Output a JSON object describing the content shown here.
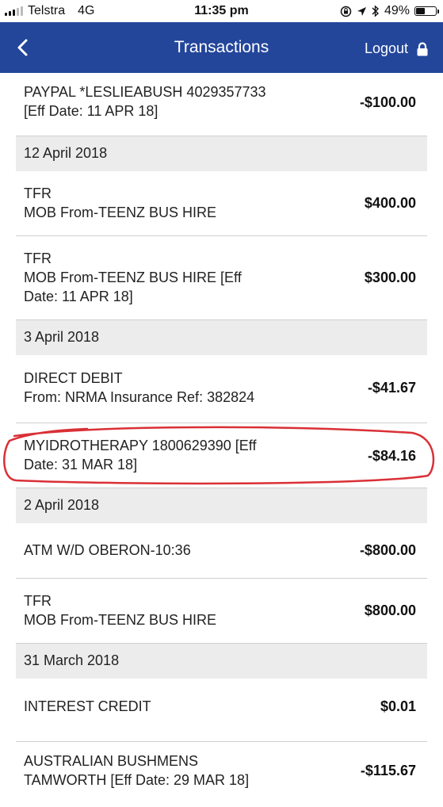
{
  "status_bar": {
    "carrier": "Telstra",
    "network": "4G",
    "time": "11:35 pm",
    "battery": "49%",
    "battery_level": 0.49
  },
  "header": {
    "title": "Transactions",
    "logout_label": "Logout"
  },
  "transactions": [
    {
      "line1": "PAYPAL *LESLIEABUSH 4029357733",
      "line2": "[Eff Date: 11 APR 18]",
      "amount": "-$100.00"
    },
    {
      "date_header": "12 April 2018"
    },
    {
      "line1": "TFR",
      "line2": "MOB From-TEENZ BUS HIRE",
      "amount": "$400.00"
    },
    {
      "line1": "TFR",
      "line2": "MOB From-TEENZ BUS HIRE [Eff",
      "line3": "Date: 11 APR 18]",
      "amount": "$300.00"
    },
    {
      "date_header": "3 April 2018"
    },
    {
      "line1": "DIRECT DEBIT",
      "line2": "From: NRMA Insurance Ref: 382824",
      "amount": "-$41.67"
    },
    {
      "line1": "MYIDROTHERAPY 1800629390 [Eff",
      "line2": "Date: 31 MAR 18]",
      "amount": "-$84.16"
    },
    {
      "date_header": "2 April 2018"
    },
    {
      "line1": "ATM W/D OBERON-10:36",
      "amount": "-$800.00"
    },
    {
      "line1": "TFR",
      "line2": "MOB From-TEENZ BUS HIRE",
      "amount": "$800.00"
    },
    {
      "date_header": "31 March 2018"
    },
    {
      "line1": "INTEREST CREDIT",
      "amount": "$0.01"
    },
    {
      "line1": "AUSTRALIAN BUSHMENS",
      "line2": "TAMWORTH [Eff Date: 29 MAR 18]",
      "amount": "-$115.67"
    }
  ],
  "colors": {
    "header_bg": "#23469b",
    "date_header_bg": "#ececec",
    "annotation": "#d93036"
  }
}
